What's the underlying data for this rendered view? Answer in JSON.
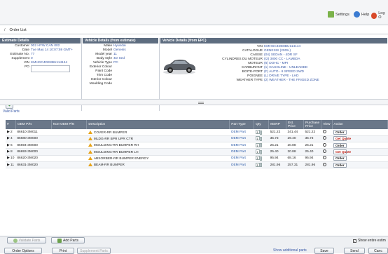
{
  "toolbar": {
    "settings_label": "Settings",
    "help_label": "Help",
    "logout_label": "Log O"
  },
  "breadcrumb": {
    "title": "Order List"
  },
  "estimate": {
    "header": "Estimate Details",
    "fields": [
      {
        "label": "Customer",
        "value": "002 HYW CAN 002"
      },
      {
        "label": "Date",
        "value": "Tue May 14 10:07:59 GMT+"
      },
      {
        "label": "Estimate No.",
        "value": "77"
      },
      {
        "label": "Supplement",
        "value": "0"
      },
      {
        "label": "VIN",
        "value": "KMHGC4DE8BU114144"
      },
      {
        "label": "PO",
        "value": ""
      }
    ],
    "add_label": "+"
  },
  "vehicle_est": {
    "header": "Vehicle Details (from estimate)",
    "fields": [
      {
        "label": "Make",
        "value": "Hyundai"
      },
      {
        "label": "Model",
        "value": "Genesis"
      },
      {
        "label": "Model year",
        "value": "11"
      },
      {
        "label": "Body style",
        "value": "4D Sed"
      },
      {
        "label": "Vehicle Type",
        "value": "PC"
      },
      {
        "label": "Exterior Colour",
        "value": ""
      },
      {
        "label": "Paint Code",
        "value": ""
      },
      {
        "label": "Trim Code",
        "value": ""
      },
      {
        "label": "Interior Colour",
        "value": ""
      },
      {
        "label": "Moulding Code",
        "value": ""
      }
    ]
  },
  "vehicle_epc": {
    "header": "Vehicle Details (from EPC)",
    "fields": [
      {
        "label": "VIN",
        "value": "KMHGC4DE8BU114144"
      },
      {
        "label": "CATALOGUE",
        "value": "GENESIS (2009-)"
      },
      {
        "label": "CAISSE",
        "value": "(04) SEDAN - 4DR SF"
      },
      {
        "label": "CYLINDRES DU MOTEUR",
        "value": "(I2) 3800 CC - LAMBDA"
      },
      {
        "label": "MOTEUR",
        "value": "(6) DOHC - MPI"
      },
      {
        "label": "CARBURANT",
        "value": "(1) GASOLINE - UNLEADED"
      },
      {
        "label": "BOITE-PORT",
        "value": "(F) AUTO - 6 SPEED 2WD"
      },
      {
        "label": "POIGNEE",
        "value": "(L) DRIVE TYPE - LHD"
      },
      {
        "label": "WEATHER TYPE",
        "value": "(2) WEATHER - THE FRIGED ZONE"
      }
    ]
  },
  "valid_parts_title": "Valid Parts",
  "columns": [
    "#",
    "OEM P/N",
    "Non-OEM P/N",
    "Description",
    "Part Type",
    "Qty",
    "MSRP",
    "Est. Price",
    "Purchase Price",
    "View",
    "Action"
  ],
  "rows": [
    {
      "num": "2",
      "oem": "86610-3M011",
      "desc": "COVER-RR BUMPER",
      "type": "OEM Part",
      "qty": "1",
      "msrp": "521.22",
      "est": "341.44",
      "purchase": "521.22",
      "action": "Order",
      "action_color": "#222222"
    },
    {
      "num": "4",
      "oem": "86680-3M000",
      "desc": "MLDG-RR BPR UPR CTR",
      "type": "OEM Part",
      "qty": "1",
      "msrp": "35.73",
      "est": "29.40",
      "purchase": "35.73",
      "action": "Get Quote",
      "action_color": "#c0241a"
    },
    {
      "num": "6",
      "oem": "86694-3M000",
      "desc": "MOULDING-RR BUMPER RH",
      "type": "OEM Part",
      "qty": "1",
      "msrp": "25.21",
      "est": "20.88",
      "purchase": "25.21",
      "action": "Order",
      "action_color": "#222222"
    },
    {
      "num": "8",
      "oem": "86693-3M000",
      "desc": "MOULDING-RR BUMPER LH",
      "type": "OEM Part",
      "qty": "1",
      "msrp": "25.40",
      "est": "20.88",
      "purchase": "25.40",
      "action": "Get Quote",
      "action_color": "#c0241a"
    },
    {
      "num": "10",
      "oem": "86620-3M020",
      "desc": "ABSORBER-RR BUMPER ENERGY",
      "type": "OEM Part",
      "qty": "1",
      "msrp": "95.94",
      "est": "68.16",
      "purchase": "95.94",
      "action": "Order",
      "action_color": "#222222"
    },
    {
      "num": "11",
      "oem": "86631-3M020",
      "desc": "BEAM-RR BUMPER",
      "type": "OEM Part",
      "qty": "1",
      "msrp": "281.96",
      "est": "257.31",
      "purchase": "281.96",
      "action": "Order",
      "action_color": "#222222"
    }
  ],
  "footer": {
    "validate_label": "Validate Parts",
    "add_parts_label": "Add Parts",
    "show_entire_label": "Show entire estim",
    "order_options_label": "Order Options",
    "print_label": "Print",
    "supplement_label": "Supplement Parts",
    "show_additional_label": "Show additional parts",
    "save_label": "Save",
    "send_label": "Send",
    "cancel_label": "Canc"
  },
  "colors": {
    "header_bg": "#5e6d80",
    "link": "#3a5aa8",
    "warn": "#e8a317",
    "get_quote": "#c0241a"
  }
}
